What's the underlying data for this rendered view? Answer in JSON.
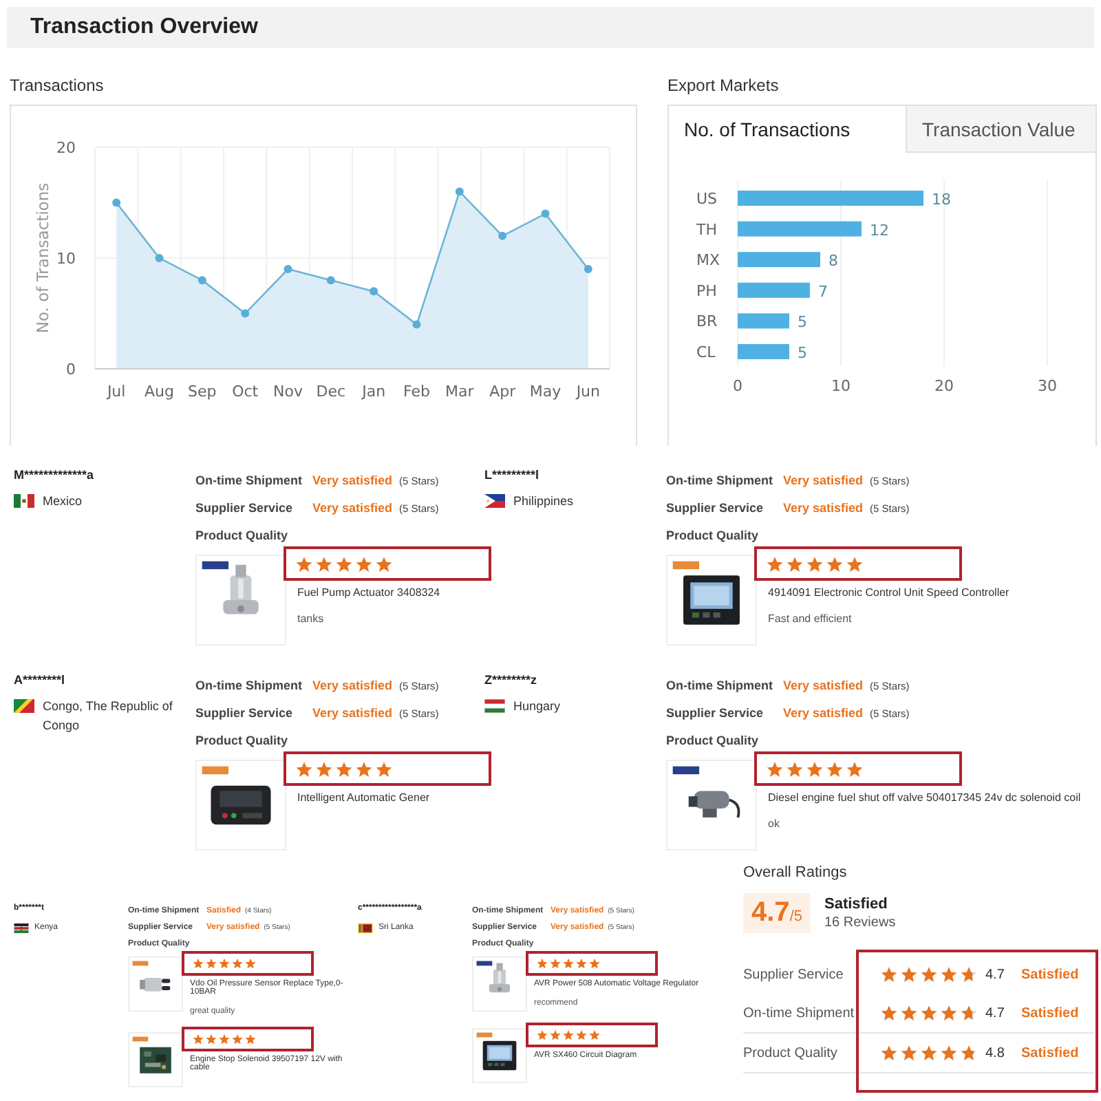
{
  "title": "Transaction Overview",
  "transactions": {
    "title": "Transactions",
    "chart_data": {
      "type": "area",
      "ylabel": "No. of Transactions",
      "categories": [
        "Jul",
        "Aug",
        "Sep",
        "Oct",
        "Nov",
        "Dec",
        "Jan",
        "Feb",
        "Mar",
        "Apr",
        "May",
        "Jun"
      ],
      "values": [
        15,
        10,
        8,
        5,
        9,
        8,
        7,
        4,
        16,
        12,
        14,
        9
      ],
      "ylim": [
        0,
        20
      ],
      "yticks": [
        0,
        10,
        20
      ]
    }
  },
  "export_markets": {
    "title": "Export Markets",
    "tabs": [
      {
        "label": "No. of Transactions",
        "selected": true
      },
      {
        "label": "Transaction Value",
        "selected": false
      }
    ],
    "chart_data": {
      "type": "bar",
      "orientation": "horizontal",
      "categories": [
        "US",
        "TH",
        "MX",
        "PH",
        "BR",
        "CL"
      ],
      "values": [
        18,
        12,
        8,
        7,
        5,
        5
      ],
      "xlim": [
        0,
        30
      ],
      "xticks": [
        0,
        10,
        20,
        30
      ],
      "data_labels": true
    }
  },
  "review_rows": [
    {
      "kind": "large",
      "reviews": [
        {
          "buyer": "M*************a",
          "country": "Mexico",
          "ratings": [
            {
              "label": "On-time Shipment",
              "verdict": "Very satisfied",
              "stars_text": "(5 Stars)"
            },
            {
              "label": "Supplier Service",
              "verdict": "Very satisfied",
              "stars_text": "(5 Stars)"
            }
          ],
          "quality_label": "Product Quality",
          "products": [
            {
              "stars": 5,
              "highlighted": true,
              "name": "Fuel Pump Actuator 3408324",
              "comment": "tanks"
            }
          ]
        },
        {
          "buyer": "L*********l",
          "country": "Philippines",
          "ratings": [
            {
              "label": "On-time Shipment",
              "verdict": "Very satisfied",
              "stars_text": "(5 Stars)"
            },
            {
              "label": "Supplier Service",
              "verdict": "Very satisfied",
              "stars_text": "(5 Stars)"
            }
          ],
          "quality_label": "Product Quality",
          "products": [
            {
              "stars": 5,
              "highlighted": true,
              "name": "4914091 Electronic Control Unit Speed Controller",
              "comment": "Fast and efficient"
            }
          ]
        }
      ]
    },
    {
      "kind": "large",
      "reviews": [
        {
          "buyer": "A********l",
          "country": "Congo, The Republic of Congo",
          "ratings": [
            {
              "label": "On-time Shipment",
              "verdict": "Very satisfied",
              "stars_text": "(5 Stars)"
            },
            {
              "label": "Supplier Service",
              "verdict": "Very satisfied",
              "stars_text": "(5 Stars)"
            }
          ],
          "quality_label": "Product Quality",
          "products": [
            {
              "stars": 5,
              "highlighted": true,
              "name": "Intelligent Automatic Gener"
            }
          ]
        },
        {
          "buyer": "Z********z",
          "country": "Hungary",
          "ratings": [
            {
              "label": "On-time Shipment",
              "verdict": "Very satisfied",
              "stars_text": "(5 Stars)"
            },
            {
              "label": "Supplier Service",
              "verdict": "Very satisfied",
              "stars_text": "(5 Stars)"
            }
          ],
          "quality_label": "Product Quality",
          "products": [
            {
              "stars": 5,
              "highlighted": true,
              "name": "Diesel engine fuel shut off valve 504017345 24v dc solenoid coil",
              "comment": "ok"
            }
          ]
        }
      ]
    },
    {
      "kind": "small",
      "reviews": [
        {
          "buyer": "b*******t",
          "country": "Kenya",
          "ratings": [
            {
              "label": "On-time Shipment",
              "verdict": "Satisfied",
              "stars_text": "(4 Stars)"
            },
            {
              "label": "Supplier Service",
              "verdict": "Very satisfied",
              "stars_text": "(5 Stars)"
            }
          ],
          "quality_label": "Product Quality",
          "products": [
            {
              "stars": 5,
              "highlighted": true,
              "name": "Vdo Oil Pressure Sensor Replace Type,0-10BAR",
              "comment": "great quality"
            },
            {
              "stars": 5,
              "highlighted": true,
              "name": "Engine Stop Solenoid 39507197 12V with cable"
            }
          ]
        },
        {
          "buyer": "c*****************a",
          "country": "Sri Lanka",
          "ratings": [
            {
              "label": "On-time Shipment",
              "verdict": "Very satisfied",
              "stars_text": "(5 Stars)"
            },
            {
              "label": "Supplier Service",
              "verdict": "Very satisfied",
              "stars_text": "(5 Stars)"
            }
          ],
          "quality_label": "Product Quality",
          "products": [
            {
              "stars": 5,
              "highlighted": true,
              "name": "AVR Power 508 Automatic Voltage Regulator",
              "comment": "recommend"
            },
            {
              "stars": 5,
              "highlighted": true,
              "name": "AVR SX460 Circuit Diagram"
            }
          ]
        }
      ]
    }
  ],
  "overall_ratings": {
    "title": "Overall Ratings",
    "score": "4.7",
    "out_of": "/5",
    "verdict": "Satisfied",
    "reviews": "16 Reviews",
    "highlighted": true,
    "rows": [
      {
        "label": "Supplier Service",
        "stars": 4.7,
        "value": "4.7",
        "verdict": "Satisfied"
      },
      {
        "label": "On-time Shipment",
        "stars": 4.7,
        "value": "4.7",
        "verdict": "Satisfied"
      },
      {
        "label": "Product Quality",
        "stars": 4.8,
        "value": "4.8",
        "verdict": "Satisfied"
      }
    ]
  }
}
